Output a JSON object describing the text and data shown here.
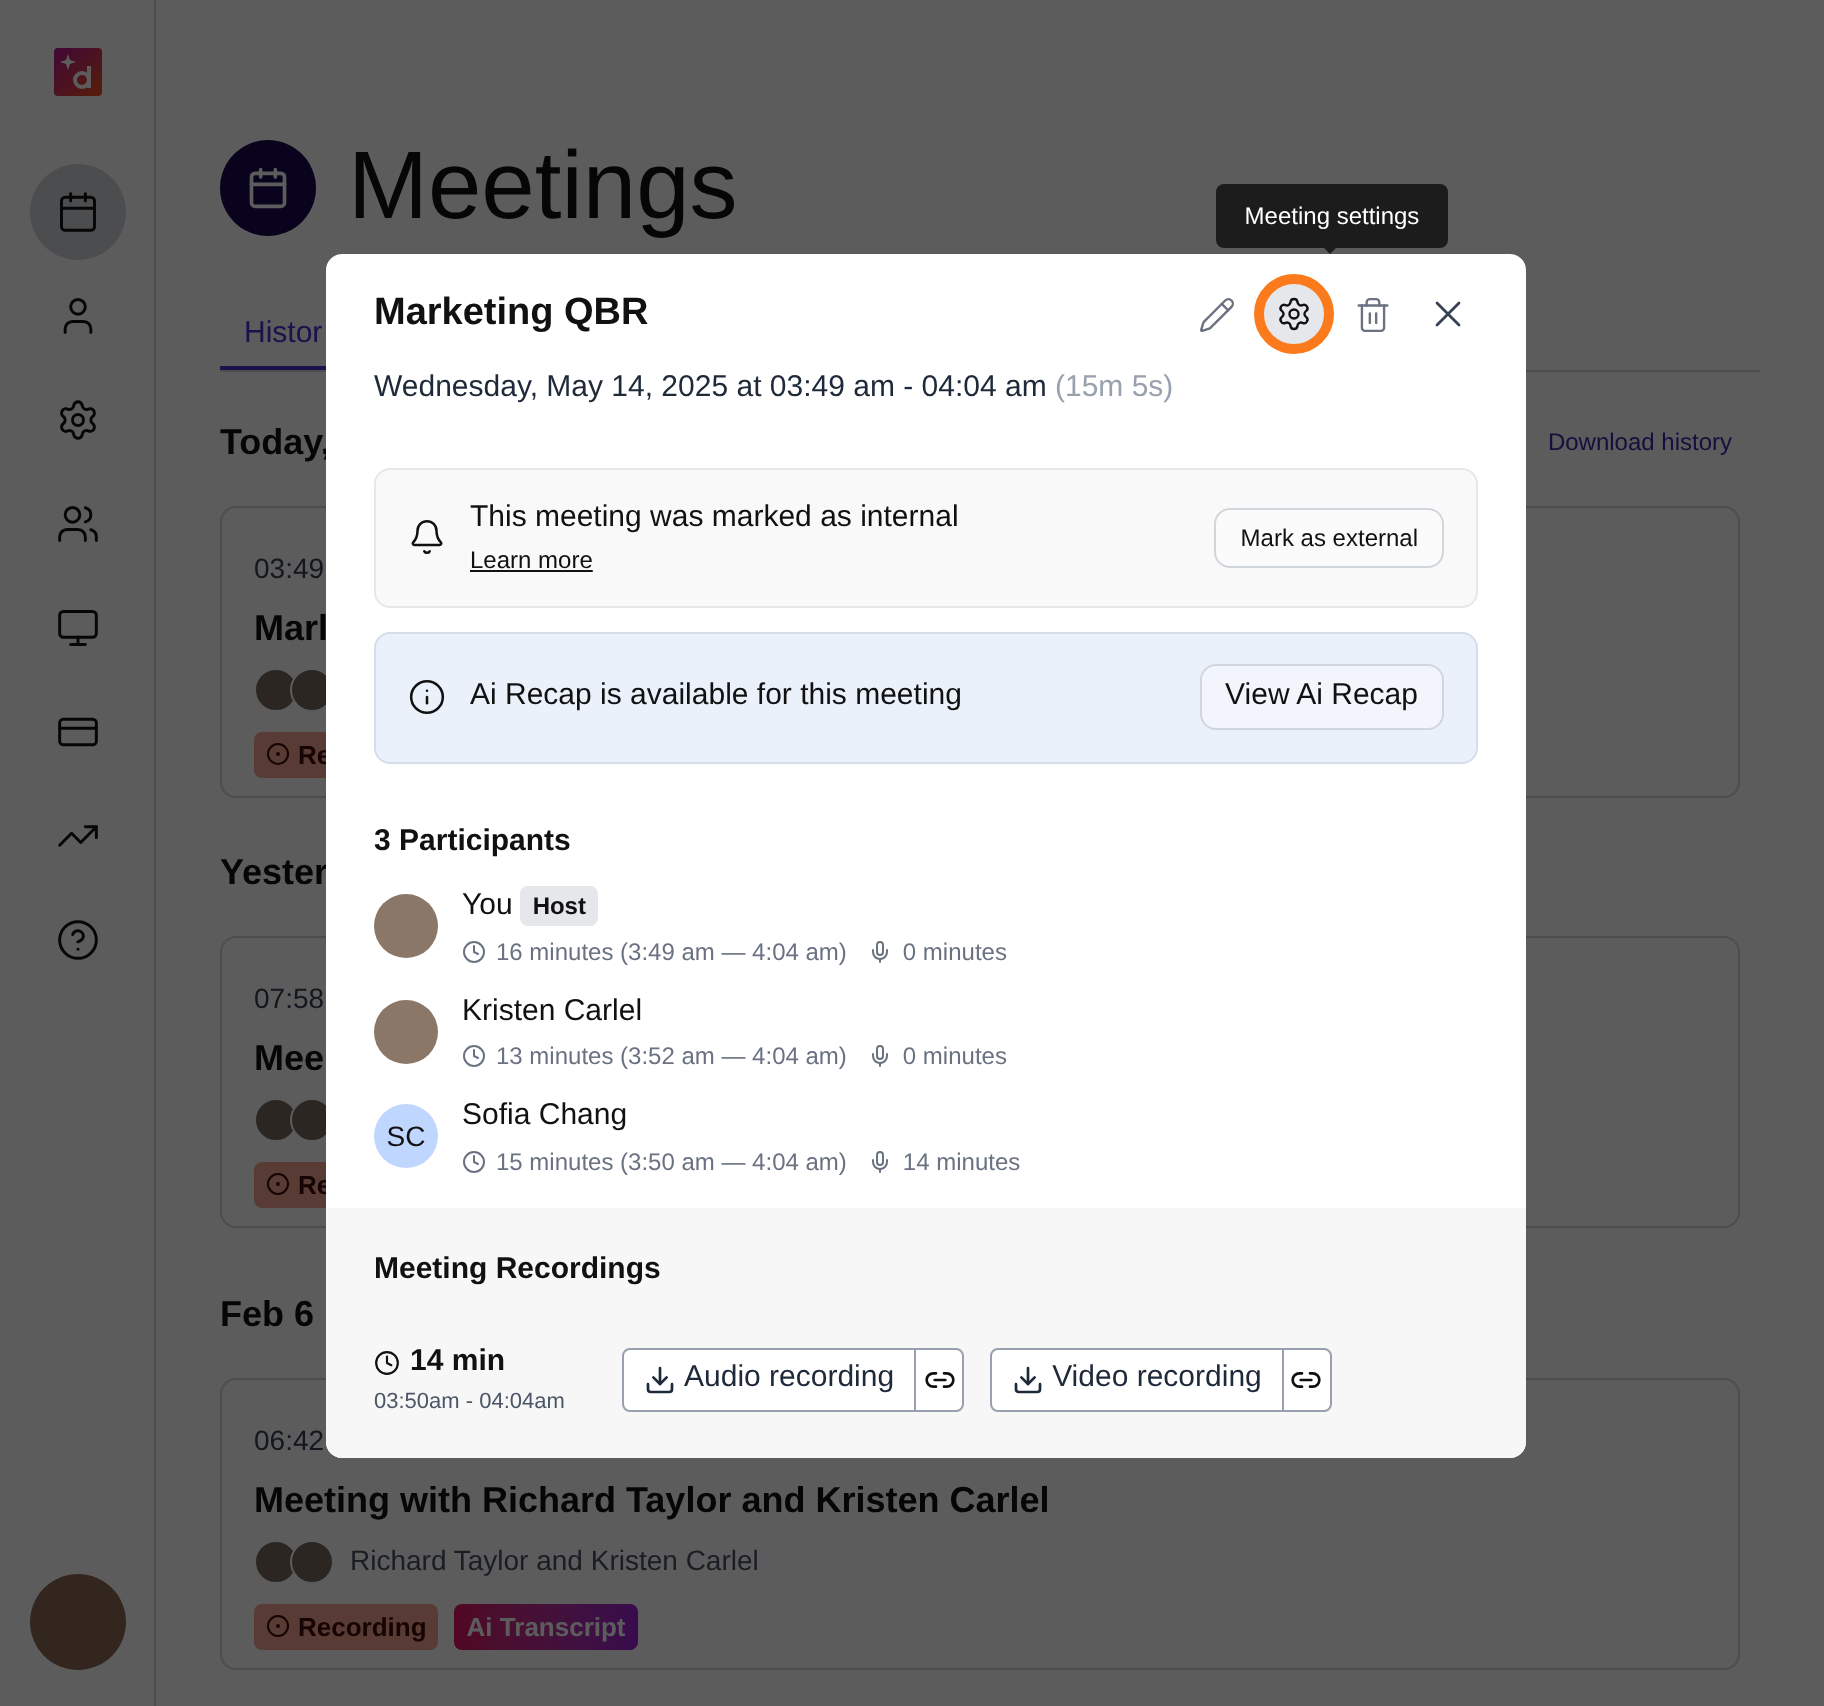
{
  "sidebar": {
    "nav": [
      {
        "selected": true
      },
      {
        "selected": false
      },
      {
        "selected": false
      },
      {
        "selected": false
      },
      {
        "selected": false
      },
      {
        "selected": false
      },
      {
        "selected": false
      },
      {
        "selected": false
      }
    ]
  },
  "page": {
    "title": "Meetings",
    "tabs": [
      {
        "label": "Histor",
        "selected": true
      }
    ],
    "download_link": "Download history",
    "groups": [
      {
        "heading": "Today,",
        "meetings": [
          {
            "time": "03:49",
            "title": "Marl",
            "badges": [
              {
                "kind": "recording",
                "label": "Re"
              }
            ]
          }
        ]
      },
      {
        "heading": "Yester",
        "meetings": [
          {
            "time": "07:58",
            "title": "Mee",
            "badges": [
              {
                "kind": "recording",
                "label": "Re"
              }
            ]
          }
        ]
      },
      {
        "heading": "Feb 6",
        "meetings": [
          {
            "time": "06:42",
            "title": "Meeting with Richard Taylor and Kristen Carlel",
            "people": "Richard Taylor and Kristen Carlel",
            "badges": [
              {
                "kind": "recording",
                "label": "Recording"
              },
              {
                "kind": "transcript",
                "label": "Ai Transcript"
              }
            ]
          }
        ]
      }
    ]
  },
  "tooltip": "Meeting settings",
  "modal": {
    "title": "Marketing QBR",
    "date": "Wednesday, May 14, 2025 at 03:49 am - 04:04 am",
    "duration": "(15m 5s)",
    "settings_highlighted": true,
    "notices": [
      {
        "kind": "internal",
        "text": "This meeting was marked as internal",
        "link": "Learn more",
        "action": "Mark as external"
      },
      {
        "kind": "recap",
        "text": "Ai Recap is available for this meeting",
        "action": "View Ai Recap"
      }
    ],
    "participants_heading": "3 Participants",
    "participants": [
      {
        "name": "You",
        "badge": "Host",
        "attended": "16 minutes (3:49 am — 4:04 am)",
        "spoke": "0 minutes"
      },
      {
        "name": "Kristen Carlel",
        "attended": "13 minutes (3:52 am — 4:04 am)",
        "spoke": "0 minutes"
      },
      {
        "name": "Sofia Chang",
        "initials": "SC",
        "attended": "15 minutes (3:50 am — 4:04 am)",
        "spoke": "14 minutes"
      }
    ],
    "recordings_heading": "Meeting Recordings",
    "recording": {
      "length": "14 min",
      "range": "03:50am - 04:04am",
      "files": [
        "Audio recording",
        "Video recording"
      ]
    }
  }
}
